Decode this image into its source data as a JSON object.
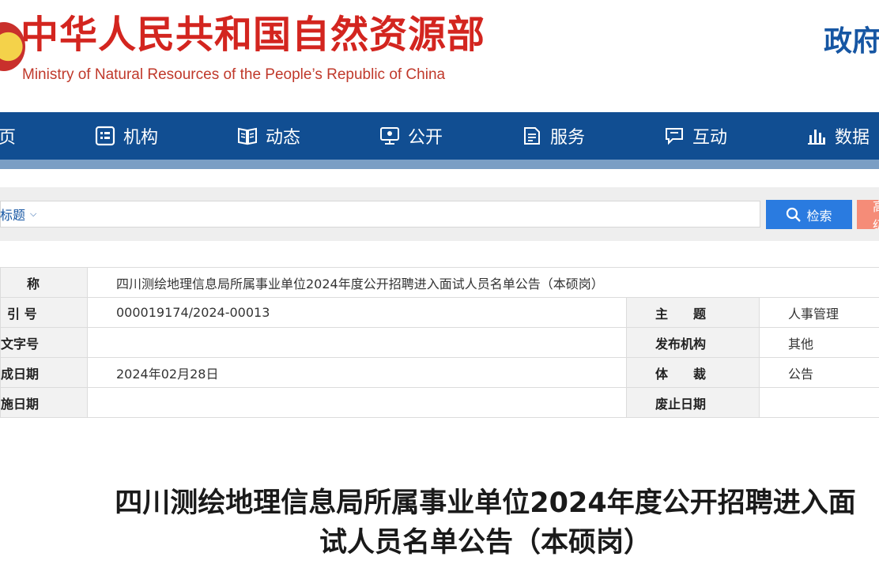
{
  "header": {
    "title_cn": "中华人民共和国自然资源部",
    "title_en": "Ministry of Natural Resources of the People’s Republic of China",
    "right_text": "政府"
  },
  "nav": {
    "items": [
      {
        "label": "页",
        "icon": "home-icon"
      },
      {
        "label": "机构",
        "icon": "organization-icon"
      },
      {
        "label": "动态",
        "icon": "book-icon"
      },
      {
        "label": "公开",
        "icon": "monitor-icon"
      },
      {
        "label": "服务",
        "icon": "service-document-icon"
      },
      {
        "label": "互动",
        "icon": "chat-bubble-icon"
      },
      {
        "label": "数据",
        "icon": "bar-chart-icon"
      }
    ],
    "bar_color": "#114e92"
  },
  "search": {
    "scope_label": "标题",
    "placeholder": "",
    "search_label": "检索",
    "advanced_label": "高级"
  },
  "info": {
    "name_label": "称",
    "name_value": "四川测绘地理信息局所属事业单位2024年度公开招聘进入面试人员名单公告（本硕岗）",
    "index_label": "引 号",
    "index_value": "000019174/2024-00013",
    "topic_label": "主　　题",
    "topic_value": "人事管理",
    "docno_label": "文字号",
    "docno_value": "",
    "issuer_label": "发布机构",
    "issuer_value": "其他",
    "date_label": "成日期",
    "date_value": "2024年02月28日",
    "genre_label": "体　　裁",
    "genre_value": "公告",
    "impl_label": "施日期",
    "impl_value": "",
    "expire_label": "废止日期",
    "expire_value": ""
  },
  "article": {
    "title": "四川测绘地理信息局所属事业单位2024年度公开招聘进入面试人员名单公告（本硕岗）"
  }
}
